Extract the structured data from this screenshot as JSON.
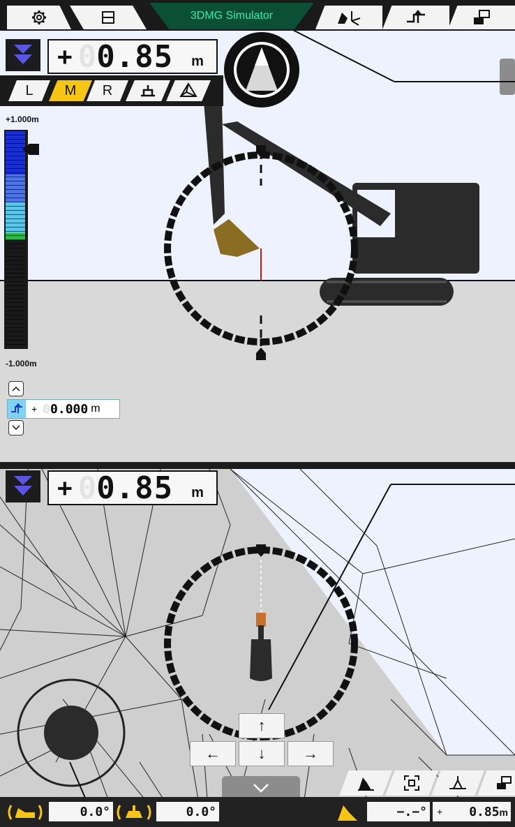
{
  "header": {
    "title": "3DMG Simulator",
    "icons": [
      "gear-icon",
      "split-view-icon",
      "axis-view-icon",
      "target-surface-icon",
      "switch-screen-icon"
    ]
  },
  "upper": {
    "depth_sign": "+",
    "depth_ghost": "0",
    "depth_value": "0.85",
    "depth_unit": "m",
    "modes": [
      "L",
      "M",
      "R"
    ],
    "active_mode": "M",
    "scale_top": "+1.000m",
    "scale_bottom": "-1.000m",
    "offset_sign": "+",
    "offset_ghost": "0",
    "offset_value": "0.000",
    "offset_unit": "m"
  },
  "lower": {
    "depth_sign": "+",
    "depth_ghost": "0",
    "depth_value": "0.85",
    "depth_unit": "m",
    "dir_up": "↑",
    "dir_down": "↓",
    "dir_left": "←",
    "dir_right": "→",
    "collapse": "⌵"
  },
  "bottom": {
    "pitch_value": "0.0°",
    "roll_value": "0.0°",
    "slope_value": "−.−°",
    "height_sign": "+",
    "height_value": "0.85",
    "height_unit": "m"
  },
  "colors": {
    "accent_yellow": "#f7c615",
    "brand_green": "#0b4f37",
    "title_text": "#3fe6b0",
    "scale_blue": "#1b2fd0",
    "arrow_purple": "#5a55e6"
  }
}
